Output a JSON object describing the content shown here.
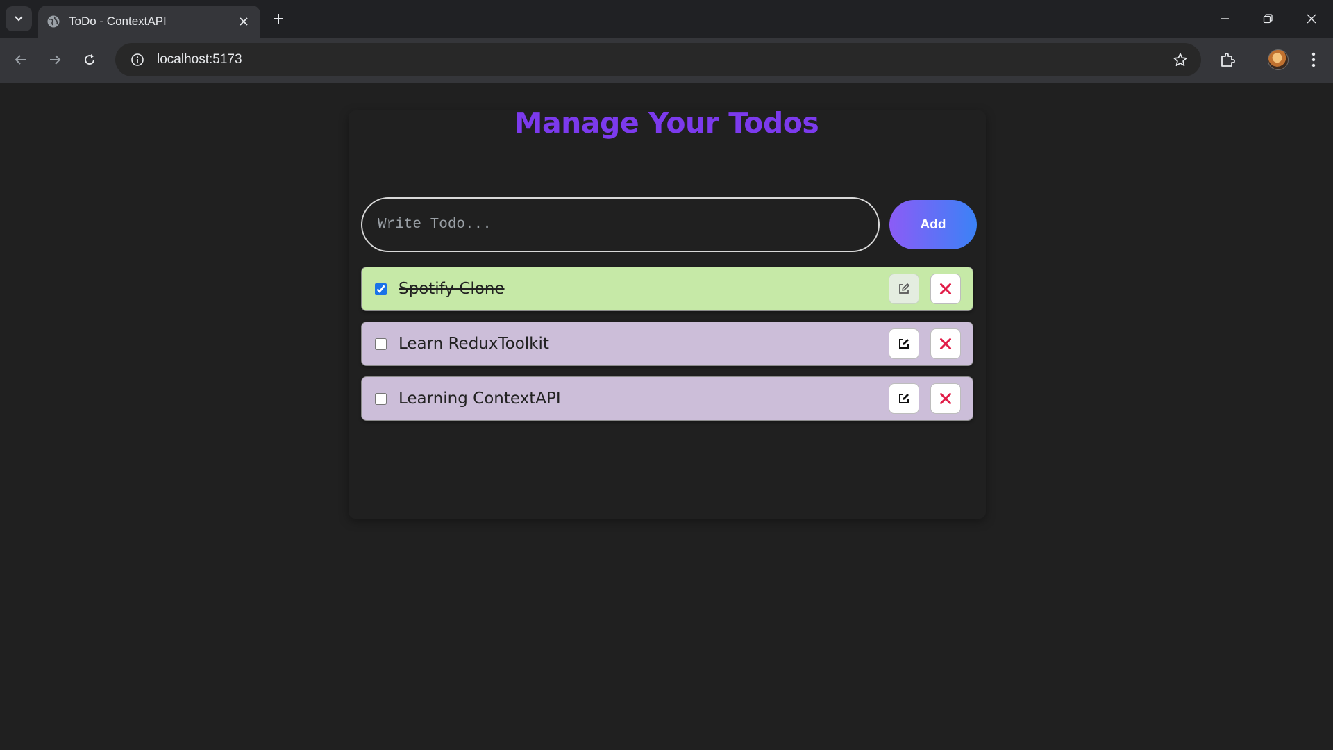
{
  "browser": {
    "tab_title": "ToDo - ContextAPI",
    "url": "localhost:5173"
  },
  "app": {
    "title": "Manage Your Todos",
    "input": {
      "placeholder": "Write Todo...",
      "value": ""
    },
    "add_label": "Add",
    "todos": [
      {
        "text": "Spotify Clone",
        "completed": true
      },
      {
        "text": "Learn ReduxToolkit",
        "completed": false
      },
      {
        "text": "Learning ContextAPI",
        "completed": false
      }
    ]
  },
  "colors": {
    "title": "#7c3aed",
    "done_bg": "#c6e9a7",
    "pending_bg": "#ccbed9",
    "delete_icon": "#e11d48",
    "add_gradient_start": "#8b5cf6",
    "add_gradient_end": "#3b82f6"
  }
}
